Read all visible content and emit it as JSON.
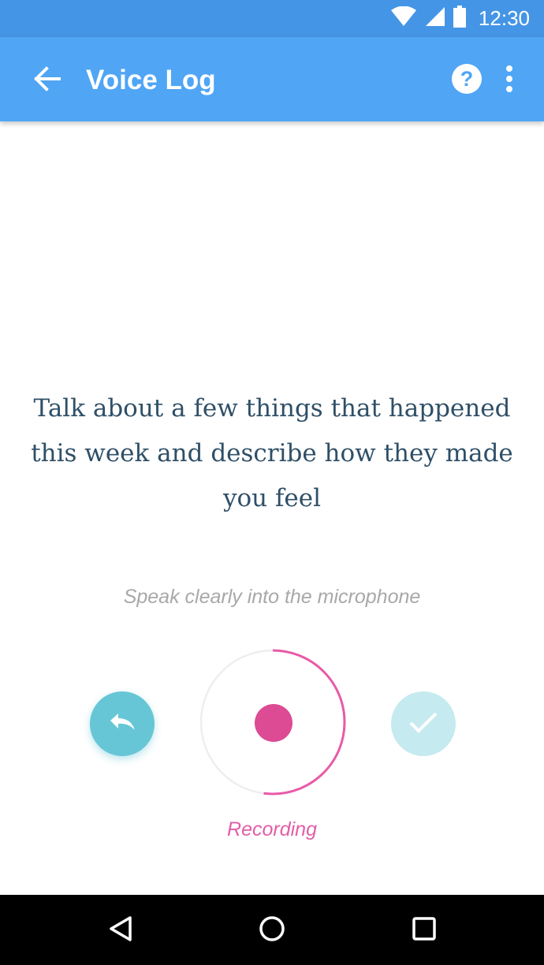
{
  "status_bar": {
    "time": "12:30",
    "icons": [
      "wifi-icon",
      "signal-icon",
      "battery-icon"
    ]
  },
  "app_bar": {
    "title": "Voice Log",
    "back_icon": "arrow-left-icon",
    "help_icon": "help-circle-icon",
    "more_icon": "more-vertical-icon"
  },
  "main": {
    "prompt": "Talk about a few things that happened this week and describe how they made you feel",
    "hint": "Speak clearly into the microphone",
    "recording_status": "Recording",
    "recording_progress": 0.52
  },
  "controls": {
    "undo_icon": "undo-icon",
    "record_icon": "record-dot-icon",
    "done_icon": "check-icon"
  },
  "nav_bar": {
    "icons": [
      "nav-back-icon",
      "nav-home-icon",
      "nav-recents-icon"
    ]
  },
  "colors": {
    "status_bar": "#4595e6",
    "app_bar": "#50a5f5",
    "prompt_text": "#2f4f67",
    "hint_text": "#a8a8a8",
    "undo_button": "#67c6d6",
    "done_button": "#c5eaf0",
    "record": "#dc4b94",
    "ring_progress": "#e85aa7",
    "ring_track": "#eeeeee",
    "recording_text": "#e35ea8"
  }
}
